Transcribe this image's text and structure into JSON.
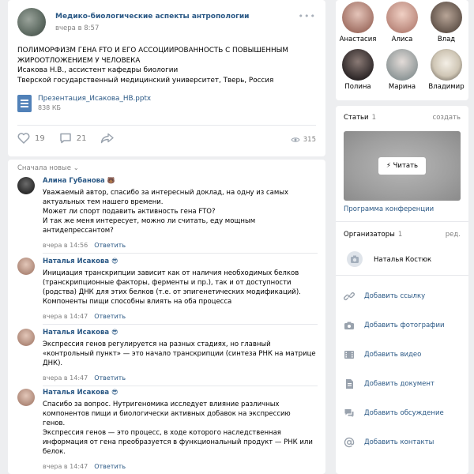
{
  "post": {
    "group_name": "Медико-биологические аспекты антропологии",
    "time": "вчера в 8:57",
    "title_line1": "ПОЛИМОРФИЗМ ГЕНА FTO И ЕГО АССОЦИИРОВАННОСТЬ С ПОВЫШЕННЫМ",
    "title_line2": "ЖИРООТЛОЖЕНИЕМ У ЧЕЛОВЕКА",
    "author": "Исакова Н.В., ассистент кафедры биологии",
    "university": "Тверской государственный медицинский университет, Тверь, Россия",
    "attachment_name": "Презентация_Исакова_НВ.pptx",
    "attachment_size": "838 КБ",
    "likes": "19",
    "comments_count": "21",
    "views": "315"
  },
  "comments_section": {
    "sort_label": "Сначала новые",
    "items": [
      {
        "author": "Алина Губанова",
        "emoji": "🐻",
        "lines": [
          "Уважаемый автор, спасибо за интересный доклад, на одну из самых",
          "актуальных тем нашего времени.",
          "Может ли спорт подавить активность гена FTO?",
          "И так же меня интересует, можно ли считать, еду мощным",
          "антидепрессантом?"
        ],
        "time": "вчера в 14:56",
        "reply": "Ответить"
      },
      {
        "author": "Наталья Исакова",
        "emoji": "😎",
        "lines": [
          "Инициация транскрипции зависит как от наличия необходимых белков",
          "(транскрипционные факторы, ферменты и пр.), так и от доступности",
          "(родства) ДНК для этих белков (т.е. от эпигенетических модификаций).",
          "Компоненты пищи способны влиять на оба процесса"
        ],
        "time": "вчера в 14:47",
        "reply": "Ответить"
      },
      {
        "author": "Наталья Исакова",
        "emoji": "😎",
        "lines": [
          "Экспрессия генов регулируется на разных стадиях, но главный",
          "«контрольный пункт» — это начало транскрипции (синтеза РНК на матрице",
          "ДНК)."
        ],
        "time": "вчера в 14:47",
        "reply": "Ответить"
      },
      {
        "author": "Наталья Исакова",
        "emoji": "😎",
        "lines": [
          "Спасибо за вопрос. Нутригеномика исследует влияние различных",
          "компонентов пищи и биологически активных добавок на экспрессию",
          "генов.",
          "Экспрессия генов — это процесс, в ходе которого наследственная",
          "информация от гена преобразуется в функциональный продукт — РНК или",
          "белок."
        ],
        "time": "вчера в 14:47",
        "reply": "Ответить"
      }
    ]
  },
  "friends": [
    {
      "name": "Анастасия",
      "color": "#c9a39a"
    },
    {
      "name": "Алиса",
      "color": "#d8b2a5"
    },
    {
      "name": "Влад",
      "color": "#8b7b6f"
    },
    {
      "name": "Полина",
      "color": "#3b3b3b"
    },
    {
      "name": "Марина",
      "color": "#9fa7a9"
    },
    {
      "name": "Владимир",
      "color": "#e8e2d6"
    }
  ],
  "sidebar": {
    "articles_label": "Статьи",
    "articles_count": "1",
    "create_label": "создать",
    "read_button": "Читать",
    "program_link": "Программа конференции",
    "organizers_label": "Организаторы",
    "organizers_count": "1",
    "edit_label": "ред.",
    "organizer_name": "Наталья Костюк",
    "actions": [
      {
        "label": "Добавить ссылку",
        "icon": "link-icon"
      },
      {
        "label": "Добавить фотографии",
        "icon": "camera-icon"
      },
      {
        "label": "Добавить видео",
        "icon": "video-icon"
      },
      {
        "label": "Добавить документ",
        "icon": "document-icon"
      },
      {
        "label": "Добавить обсуждение",
        "icon": "discussion-icon"
      },
      {
        "label": "Добавить контакты",
        "icon": "at-icon"
      }
    ]
  },
  "colors": {
    "link": "#2a5885",
    "muted": "#828282",
    "icon": "#99a2ad",
    "background": "#edeef0"
  }
}
